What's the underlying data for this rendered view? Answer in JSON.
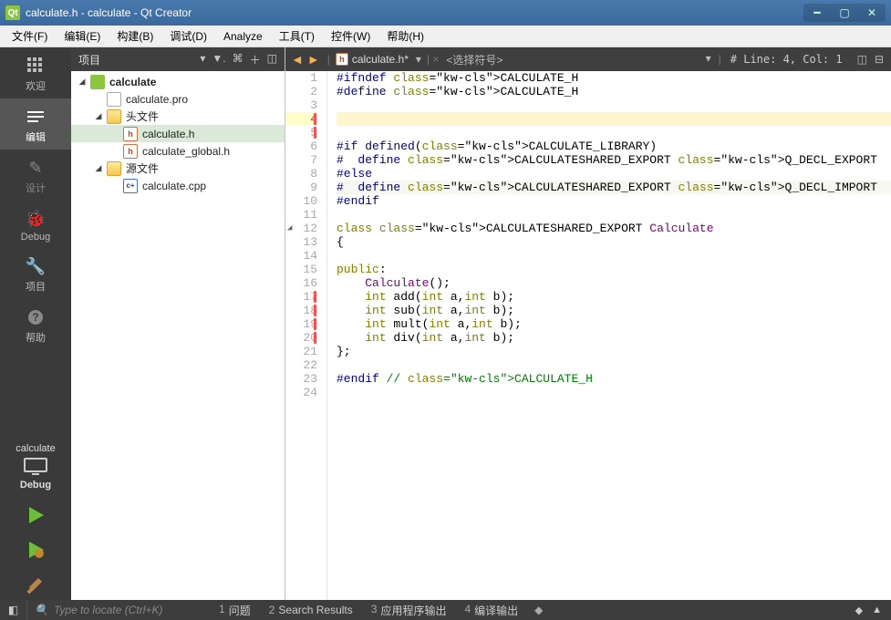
{
  "titlebar": {
    "title": "calculate.h - calculate - Qt Creator"
  },
  "menubar": {
    "items": [
      "文件(F)",
      "编辑(E)",
      "构建(B)",
      "调试(D)",
      "Analyze",
      "工具(T)",
      "控件(W)",
      "帮助(H)"
    ]
  },
  "modebar": {
    "welcome": "欢迎",
    "edit": "编辑",
    "design": "设计",
    "debug": "Debug",
    "projects": "项目",
    "help": "帮助",
    "kit": "calculate",
    "kit_cfg": "Debug"
  },
  "project_panel": {
    "title": "项目",
    "tree": {
      "root": "calculate",
      "pro": "calculate.pro",
      "headers_label": "头文件",
      "header1": "calculate.h",
      "header2": "calculate_global.h",
      "sources_label": "源文件",
      "source1": "calculate.cpp"
    }
  },
  "editor_top": {
    "filename": "calculate.h*",
    "symbol": "<选择符号>",
    "linecol_prefix": "# ",
    "linecol": "Line: 4, Col: 1"
  },
  "code": {
    "total_lines": 24,
    "lines": [
      {
        "n": 1,
        "raw": "#ifndef CALCULATE_H"
      },
      {
        "n": 2,
        "raw": "#define CALCULATE_H"
      },
      {
        "n": 3,
        "raw": ""
      },
      {
        "n": 4,
        "raw": "",
        "cur": true,
        "r": true
      },
      {
        "n": 5,
        "raw": "",
        "r": true
      },
      {
        "n": 6,
        "raw": "#if defined(CALCULATE_LIBRARY)"
      },
      {
        "n": 7,
        "raw": "#  define CALCULATESHARED_EXPORT Q_DECL_EXPORT"
      },
      {
        "n": 8,
        "raw": "#else"
      },
      {
        "n": 9,
        "raw": "#  define CALCULATESHARED_EXPORT Q_DECL_IMPORT",
        "hl": true
      },
      {
        "n": 10,
        "raw": "#endif"
      },
      {
        "n": 11,
        "raw": ""
      },
      {
        "n": 12,
        "raw": "class CALCULATESHARED_EXPORT Calculate",
        "fold": true
      },
      {
        "n": 13,
        "raw": "{"
      },
      {
        "n": 14,
        "raw": ""
      },
      {
        "n": 15,
        "raw": "public:"
      },
      {
        "n": 16,
        "raw": "    Calculate();"
      },
      {
        "n": 17,
        "raw": "    int add(int a,int b);",
        "r": true
      },
      {
        "n": 18,
        "raw": "    int sub(int a,int b);",
        "r": true
      },
      {
        "n": 19,
        "raw": "    int mult(int a,int b);",
        "r": true
      },
      {
        "n": 20,
        "raw": "    int div(int a,int b);",
        "r": true
      },
      {
        "n": 21,
        "raw": "};"
      },
      {
        "n": 22,
        "raw": ""
      },
      {
        "n": 23,
        "raw": "#endif // CALCULATE_H"
      },
      {
        "n": 24,
        "raw": ""
      }
    ]
  },
  "statusbar": {
    "search_placeholder": "Type to locate (Ctrl+K)",
    "tabs": [
      {
        "n": "1",
        "label": "问题"
      },
      {
        "n": "2",
        "label": "Search Results"
      },
      {
        "n": "3",
        "label": "应用程序输出"
      },
      {
        "n": "4",
        "label": "编译输出"
      }
    ]
  }
}
